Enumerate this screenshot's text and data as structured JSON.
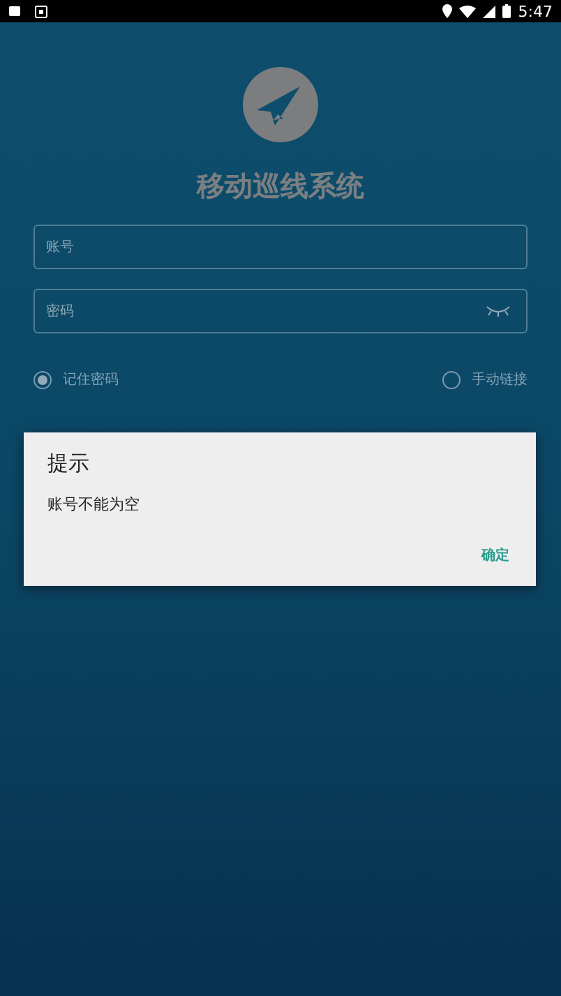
{
  "status_bar": {
    "time": "5:47"
  },
  "app": {
    "title": "移动巡线系统"
  },
  "fields": [
    {
      "placeholder": "账号",
      "kind": "text"
    },
    {
      "placeholder": "密码",
      "kind": "password"
    }
  ],
  "options": [
    {
      "label": "记住密码",
      "selected": true
    },
    {
      "label": "手动链接",
      "selected": false
    }
  ],
  "dialog": {
    "title": "提示",
    "message": "账号不能为空",
    "buttons": [
      "确定"
    ]
  }
}
